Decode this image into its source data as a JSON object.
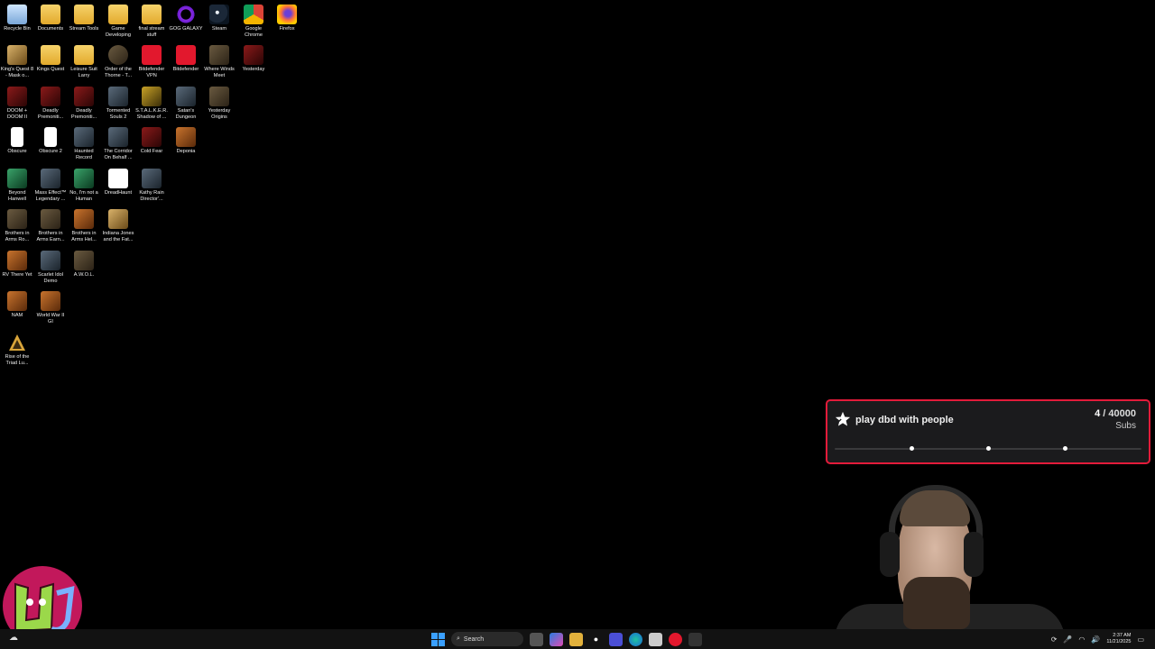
{
  "desktop": {
    "icons": [
      {
        "label": "Recycle Bin",
        "icon": "recycle-bin-icon"
      },
      {
        "label": "Documents",
        "icon": "folder-icon"
      },
      {
        "label": "Stream Tools",
        "icon": "folder-icon"
      },
      {
        "label": "Game Developing",
        "icon": "folder-icon"
      },
      {
        "label": "final stream stuff",
        "icon": "folder-icon"
      },
      {
        "label": "GOG GALAXY",
        "icon": "gog-galaxy-icon"
      },
      {
        "label": "Steam",
        "icon": "steam-icon"
      },
      {
        "label": "Google Chrome",
        "icon": "chrome-icon"
      },
      {
        "label": "Firefox",
        "icon": "firefox-icon"
      },
      {
        "label": "King's Quest 8 - Mask o...",
        "icon": "game-icon"
      },
      {
        "label": "Kings Quest",
        "icon": "folder-icon"
      },
      {
        "label": "Leisure Suit Larry",
        "icon": "folder-icon"
      },
      {
        "label": "Order of the Thorne - T...",
        "icon": "game-icon"
      },
      {
        "label": "Bitdefender VPN",
        "icon": "bitdefender-vpn-icon"
      },
      {
        "label": "Bitdefender",
        "icon": "bitdefender-icon"
      },
      {
        "label": "Where Winds Meet",
        "icon": "game-icon"
      },
      {
        "label": "Yesterday",
        "icon": "game-icon"
      },
      {
        "label": "DOOM + DOOM II",
        "icon": "game-icon"
      },
      {
        "label": "Deadly Premoniti...",
        "icon": "game-icon"
      },
      {
        "label": "Deadly Premoniti...",
        "icon": "game-icon"
      },
      {
        "label": "Tormented Souls 2",
        "icon": "game-icon"
      },
      {
        "label": "S.T.A.L.K.E.R. Shadow of ...",
        "icon": "game-icon"
      },
      {
        "label": "Satan's Dungeon",
        "icon": "game-icon"
      },
      {
        "label": "Yesterday Origins",
        "icon": "game-icon"
      },
      {
        "label": "Obscure",
        "icon": "document-icon"
      },
      {
        "label": "Obscure 2",
        "icon": "document-icon"
      },
      {
        "label": "Haunted Record",
        "icon": "game-icon"
      },
      {
        "label": "The Corridor On Behalf ...",
        "icon": "game-icon"
      },
      {
        "label": "Cold Fear",
        "icon": "game-icon"
      },
      {
        "label": "Deponia",
        "icon": "game-icon"
      },
      {
        "label": "Beyond Hanwell",
        "icon": "game-icon"
      },
      {
        "label": "Mass Effect™ Legendary ...",
        "icon": "game-icon"
      },
      {
        "label": "No, I'm not a Human",
        "icon": "game-icon"
      },
      {
        "label": "DreadHaunt",
        "icon": "game-icon"
      },
      {
        "label": "Kathy Rain Director'...",
        "icon": "game-icon"
      },
      {
        "label": "Brothers in Arms Ro...",
        "icon": "game-icon"
      },
      {
        "label": "Brothers in Arms Earn...",
        "icon": "game-icon"
      },
      {
        "label": "Brothers in Arms Hel...",
        "icon": "game-icon"
      },
      {
        "label": "Indiana Jones and the Fat...",
        "icon": "game-icon"
      },
      {
        "label": "RV There Yet",
        "icon": "game-icon"
      },
      {
        "label": "Scarlet Idol Demo",
        "icon": "game-icon"
      },
      {
        "label": "A.W.O.L.",
        "icon": "game-icon"
      },
      {
        "label": "NAM",
        "icon": "game-icon"
      },
      {
        "label": "World War II GI",
        "icon": "game-icon"
      },
      {
        "label": "Rise of the Triad Lu...",
        "icon": "game-icon"
      }
    ]
  },
  "goal_widget": {
    "title": "play dbd with people",
    "current": "4",
    "separator": " / ",
    "target": "40000",
    "unit": "Subs",
    "progress": 0.0001,
    "colors": {
      "border": "#e31b3a",
      "background": "#1b1b1d"
    }
  },
  "taskbar": {
    "search_placeholder": "Search",
    "clock_time": "2:37 AM",
    "clock_date": "11/21/2025"
  }
}
